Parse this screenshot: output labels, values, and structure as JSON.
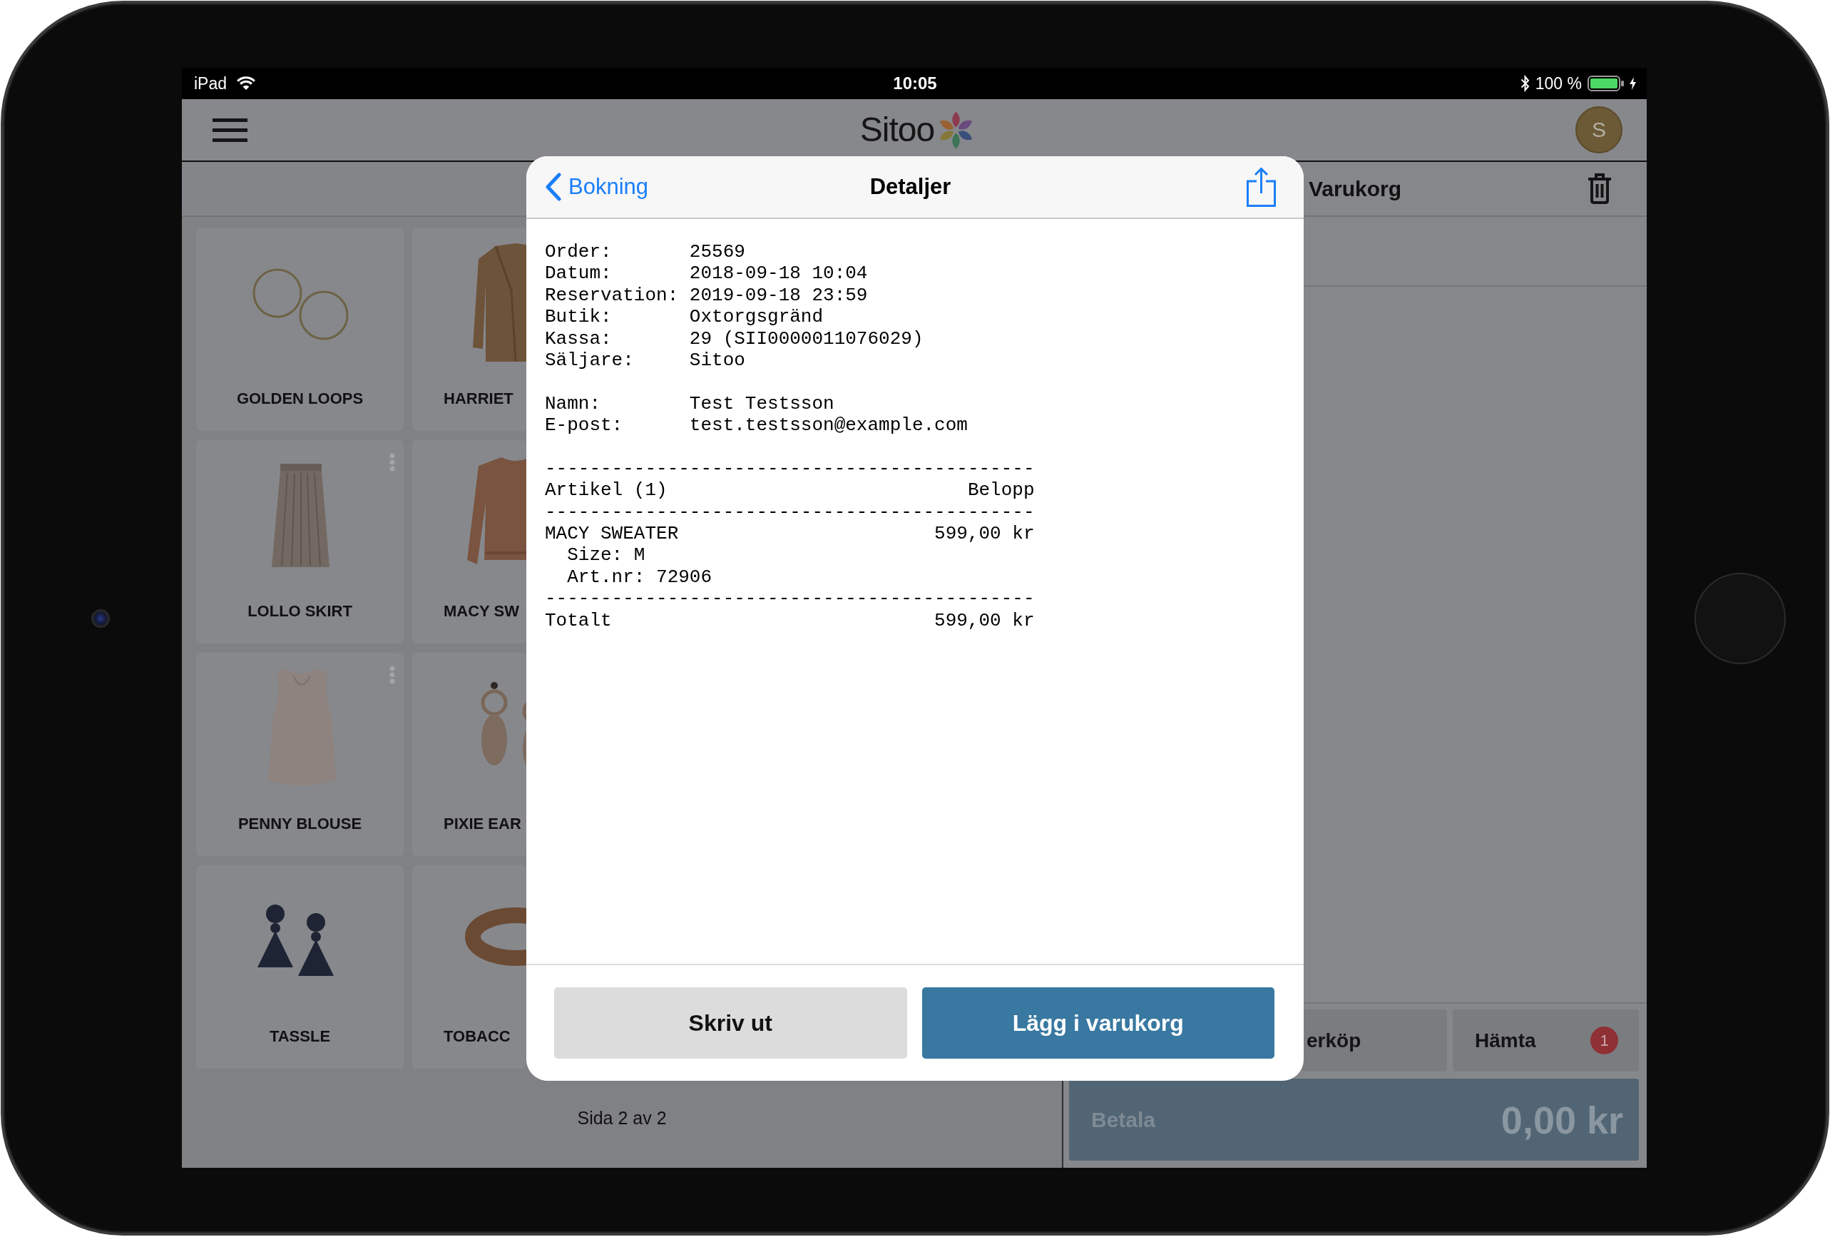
{
  "status_bar": {
    "device": "iPad",
    "time": "10:05",
    "battery": "100 %"
  },
  "app_header": {
    "logo": "Sitoo",
    "avatar": "S"
  },
  "products": {
    "tiles": [
      {
        "name": "GOLDEN LOOPS",
        "kind": "full",
        "more_menu": false
      },
      {
        "name": "HARRIET",
        "kind": "covered",
        "more_menu": false
      },
      {
        "name": "LOLLO SKIRT",
        "kind": "full",
        "more_menu": true
      },
      {
        "name": "MACY SW",
        "kind": "covered",
        "more_menu": false
      },
      {
        "name": "PENNY BLOUSE",
        "kind": "full",
        "more_menu": true
      },
      {
        "name": "PIXIE EAR",
        "kind": "covered",
        "more_menu": false
      },
      {
        "name": "TASSLE",
        "kind": "full",
        "more_menu": false
      },
      {
        "name": "TOBACC",
        "kind": "covered",
        "more_menu": false
      }
    ],
    "pager": "Sida 2 av 2"
  },
  "cart": {
    "title": "Varukorg",
    "buttons": [
      {
        "label": "erköp",
        "kind": "covered"
      },
      {
        "label": "Hämta",
        "kind": "full",
        "badge": "1"
      }
    ],
    "pay": {
      "label": "Betala",
      "amount": "0,00 kr"
    }
  },
  "dialog": {
    "back": "Bokning",
    "title": "Detaljer",
    "receipt": [
      {
        "kind": "field",
        "label": "Order:",
        "value": "25569"
      },
      {
        "kind": "field",
        "label": "Datum:",
        "value": "2018-09-18 10:04"
      },
      {
        "kind": "field",
        "label": "Reservation:",
        "value": "2019-09-18 23:59"
      },
      {
        "kind": "field",
        "label": "Butik:",
        "value": "Oxtorgsgränd"
      },
      {
        "kind": "field",
        "label": "Kassa:",
        "value": "29 (SII0000011076029)"
      },
      {
        "kind": "field",
        "label": "Säljare:",
        "value": "Sitoo"
      },
      {
        "kind": "gap"
      },
      {
        "kind": "field",
        "label": "Namn:",
        "value": "Test Testsson"
      },
      {
        "kind": "field",
        "label": "E-post:",
        "value": "test.testsson@example.com"
      },
      {
        "kind": "gap"
      },
      {
        "kind": "rule",
        "text": "--------------------------------------------"
      },
      {
        "kind": "split",
        "left": "Artikel (1)",
        "right": "Belopp"
      },
      {
        "kind": "rule",
        "text": "--------------------------------------------"
      },
      {
        "kind": "split",
        "left": "MACY SWEATER",
        "right": "599,00 kr"
      },
      {
        "kind": "detail",
        "text": "Size: M"
      },
      {
        "kind": "detail",
        "text": "Art.nr: 72906"
      },
      {
        "kind": "rule",
        "text": "--------------------------------------------"
      },
      {
        "kind": "split",
        "left": "Totalt",
        "right": "599,00 kr"
      }
    ],
    "buttons": [
      {
        "label": "Skriv ut",
        "kind": "secondary"
      },
      {
        "label": "Lägg i varukorg",
        "kind": "primary"
      }
    ]
  }
}
